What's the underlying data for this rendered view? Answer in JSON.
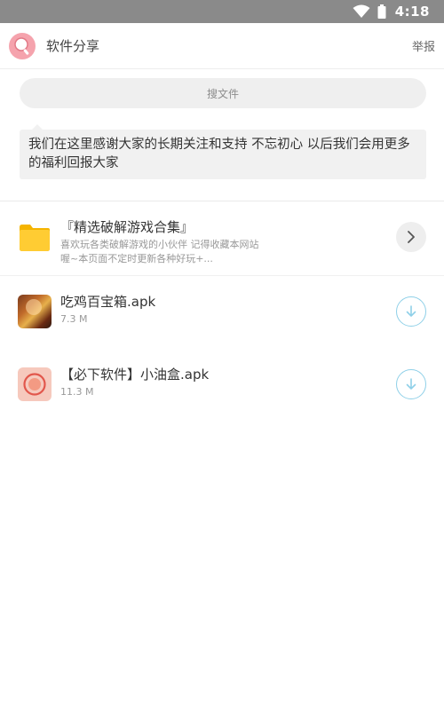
{
  "status_bar": {
    "time": "4:18"
  },
  "header": {
    "title": "软件分享",
    "report_label": "举报"
  },
  "search": {
    "placeholder": "搜文件"
  },
  "notice": {
    "text": "我们在这里感谢大家的长期关注和支持 不忘初心 以后我们会用更多的福利回报大家"
  },
  "folder": {
    "name": "『精选破解游戏合集』",
    "desc_line1": "喜欢玩各类破解游戏的小伙伴 记得收藏本网站",
    "desc_line2": "喔~本页面不定时更新各种好玩+..."
  },
  "files": [
    {
      "name": "吃鸡百宝箱.apk",
      "size": "7.3 M",
      "icon": "game-app-icon"
    },
    {
      "name": "【必下软件】小油盒.apk",
      "size": "11.3 M",
      "icon": "oil-box-app-icon"
    }
  ],
  "colors": {
    "status_bar_bg": "#8a8a8a",
    "download_accent": "#8fd0e8",
    "folder_yellow": "#ffcc33",
    "avatar_pink": "#f5a3ad"
  }
}
